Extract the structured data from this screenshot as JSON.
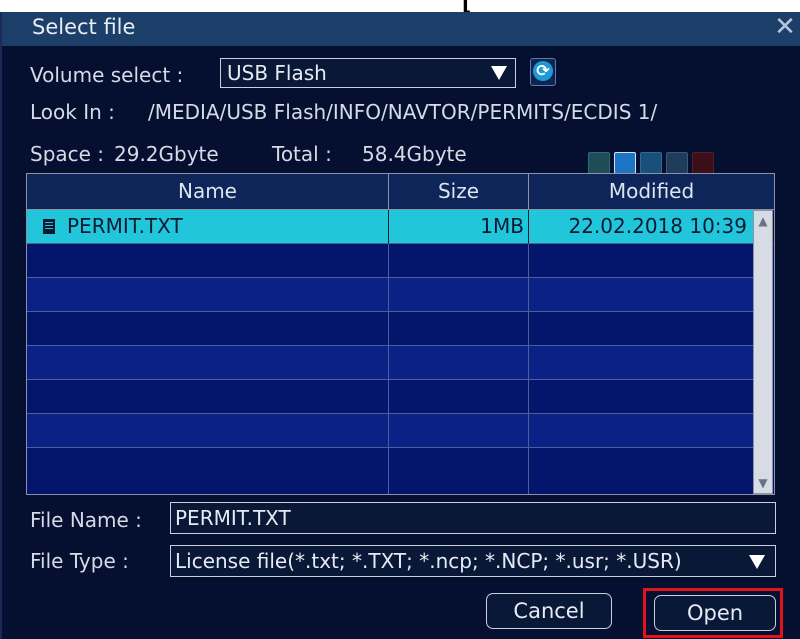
{
  "window": {
    "title": "Select file"
  },
  "volume": {
    "label": "Volume select :",
    "value": "USB Flash"
  },
  "look_in": {
    "label": "Look In :",
    "path": "/MEDIA/USB Flash/INFO/NAVTOR/PERMITS/ECDIS 1/"
  },
  "space": {
    "label": "Space :",
    "value": "29.2Gbyte",
    "total_label": "Total :",
    "total_value": "58.4Gbyte"
  },
  "toolbar_icons": [
    "folder-up-icon",
    "new-folder-icon",
    "copy-folder-icon",
    "properties-icon",
    "delete-icon"
  ],
  "table": {
    "columns": [
      "Name",
      "Size",
      "Modified"
    ],
    "rows": [
      {
        "name": "PERMIT.TXT",
        "size": "1MB",
        "modified": "22.02.2018 10:39"
      }
    ]
  },
  "file_name": {
    "label": "File Name :",
    "value": "PERMIT.TXT"
  },
  "file_type": {
    "label": "File Type :",
    "value": "License file(*.txt; *.TXT; *.ncp; *.NCP; *.usr; *.USR)"
  },
  "buttons": {
    "cancel": "Cancel",
    "open": "Open"
  },
  "colors": {
    "background": "#050f30",
    "selected_row": "#22c6db",
    "highlight": "#e2141b"
  }
}
